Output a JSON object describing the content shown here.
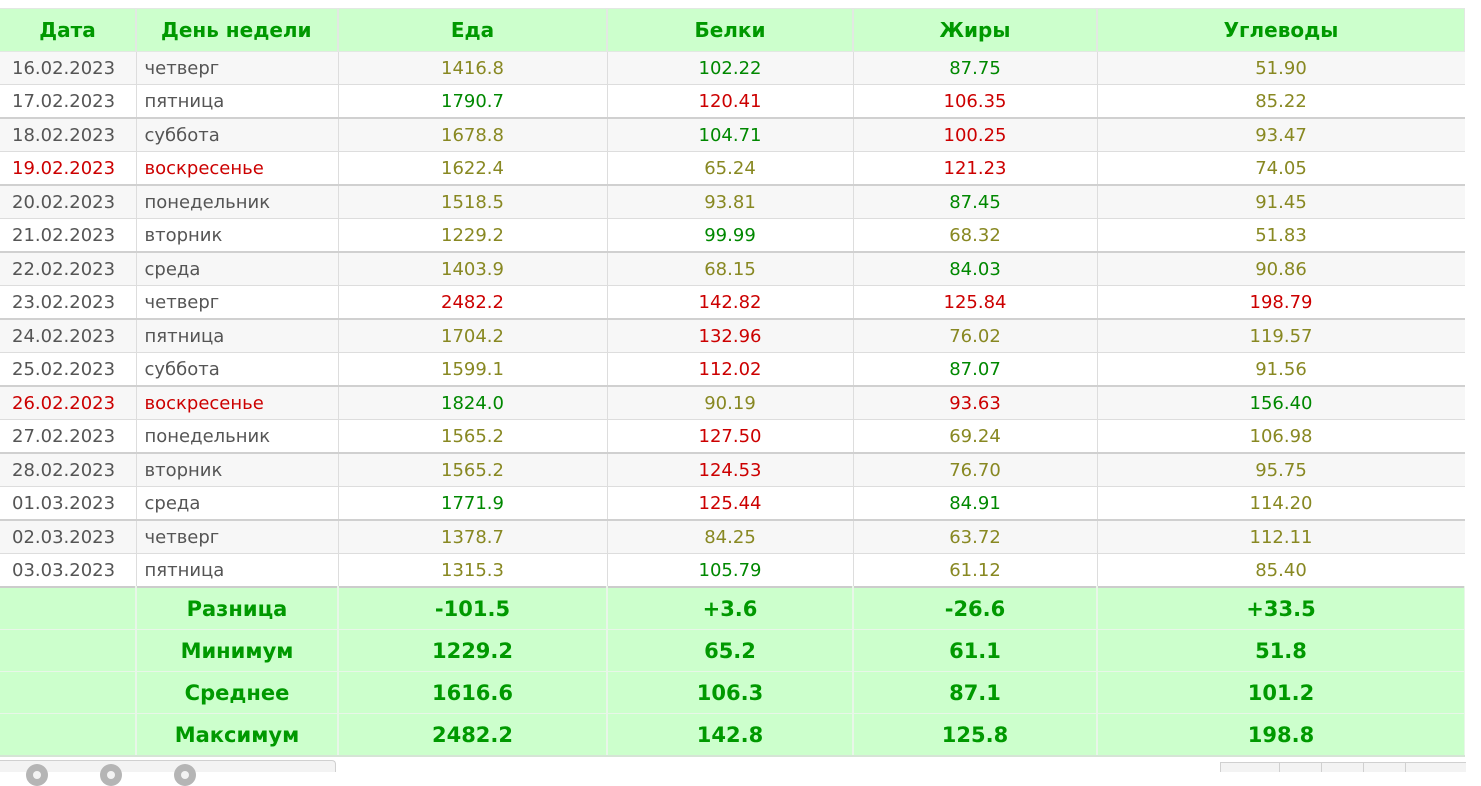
{
  "headers": {
    "date": "Дата",
    "weekday": "День недели",
    "food": "Еда",
    "protein": "Белки",
    "fat": "Жиры",
    "carbs": "Углеводы"
  },
  "rows": [
    {
      "date": "16.02.2023",
      "weekday": "четверг",
      "food": "1416.8",
      "protein": "102.22",
      "fat": "87.75",
      "carbs": "51.90",
      "weekend": false,
      "group_end": false,
      "tones": [
        "mid",
        "low",
        "low",
        "mid"
      ]
    },
    {
      "date": "17.02.2023",
      "weekday": "пятница",
      "food": "1790.7",
      "protein": "120.41",
      "fat": "106.35",
      "carbs": "85.22",
      "weekend": false,
      "group_end": true,
      "tones": [
        "low",
        "high",
        "high",
        "mid"
      ]
    },
    {
      "date": "18.02.2023",
      "weekday": "суббота",
      "food": "1678.8",
      "protein": "104.71",
      "fat": "100.25",
      "carbs": "93.47",
      "weekend": false,
      "group_end": false,
      "tones": [
        "mid",
        "low",
        "high",
        "mid"
      ]
    },
    {
      "date": "19.02.2023",
      "weekday": "воскресенье",
      "food": "1622.4",
      "protein": "65.24",
      "fat": "121.23",
      "carbs": "74.05",
      "weekend": true,
      "group_end": true,
      "tones": [
        "mid",
        "mid",
        "high",
        "mid"
      ]
    },
    {
      "date": "20.02.2023",
      "weekday": "понедельник",
      "food": "1518.5",
      "protein": "93.81",
      "fat": "87.45",
      "carbs": "91.45",
      "weekend": false,
      "group_end": false,
      "tones": [
        "mid",
        "mid",
        "low",
        "mid"
      ]
    },
    {
      "date": "21.02.2023",
      "weekday": "вторник",
      "food": "1229.2",
      "protein": "99.99",
      "fat": "68.32",
      "carbs": "51.83",
      "weekend": false,
      "group_end": true,
      "tones": [
        "mid",
        "low",
        "mid",
        "mid"
      ]
    },
    {
      "date": "22.02.2023",
      "weekday": "среда",
      "food": "1403.9",
      "protein": "68.15",
      "fat": "84.03",
      "carbs": "90.86",
      "weekend": false,
      "group_end": false,
      "tones": [
        "mid",
        "mid",
        "low",
        "mid"
      ]
    },
    {
      "date": "23.02.2023",
      "weekday": "четверг",
      "food": "2482.2",
      "protein": "142.82",
      "fat": "125.84",
      "carbs": "198.79",
      "weekend": false,
      "group_end": true,
      "tones": [
        "high",
        "high",
        "high",
        "high"
      ]
    },
    {
      "date": "24.02.2023",
      "weekday": "пятница",
      "food": "1704.2",
      "protein": "132.96",
      "fat": "76.02",
      "carbs": "119.57",
      "weekend": false,
      "group_end": false,
      "tones": [
        "mid",
        "high",
        "mid",
        "mid"
      ]
    },
    {
      "date": "25.02.2023",
      "weekday": "суббота",
      "food": "1599.1",
      "protein": "112.02",
      "fat": "87.07",
      "carbs": "91.56",
      "weekend": false,
      "group_end": true,
      "tones": [
        "mid",
        "high",
        "low",
        "mid"
      ]
    },
    {
      "date": "26.02.2023",
      "weekday": "воскресенье",
      "food": "1824.0",
      "protein": "90.19",
      "fat": "93.63",
      "carbs": "156.40",
      "weekend": true,
      "group_end": false,
      "tones": [
        "low",
        "mid",
        "high",
        "low"
      ]
    },
    {
      "date": "27.02.2023",
      "weekday": "понедельник",
      "food": "1565.2",
      "protein": "127.50",
      "fat": "69.24",
      "carbs": "106.98",
      "weekend": false,
      "group_end": true,
      "tones": [
        "mid",
        "high",
        "mid",
        "mid"
      ]
    },
    {
      "date": "28.02.2023",
      "weekday": "вторник",
      "food": "1565.2",
      "protein": "124.53",
      "fat": "76.70",
      "carbs": "95.75",
      "weekend": false,
      "group_end": false,
      "tones": [
        "mid",
        "high",
        "mid",
        "mid"
      ]
    },
    {
      "date": "01.03.2023",
      "weekday": "среда",
      "food": "1771.9",
      "protein": "125.44",
      "fat": "84.91",
      "carbs": "114.20",
      "weekend": false,
      "group_end": true,
      "tones": [
        "low",
        "high",
        "low",
        "mid"
      ]
    },
    {
      "date": "02.03.2023",
      "weekday": "четверг",
      "food": "1378.7",
      "protein": "84.25",
      "fat": "63.72",
      "carbs": "112.11",
      "weekend": false,
      "group_end": false,
      "tones": [
        "mid",
        "mid",
        "mid",
        "mid"
      ]
    },
    {
      "date": "03.03.2023",
      "weekday": "пятница",
      "food": "1315.3",
      "protein": "105.79",
      "fat": "61.12",
      "carbs": "85.40",
      "weekend": false,
      "group_end": false,
      "tones": [
        "mid",
        "low",
        "mid",
        "mid"
      ]
    }
  ],
  "summary": [
    {
      "label": "Разница",
      "food": "-101.5",
      "protein": "+3.6",
      "fat": "-26.6",
      "carbs": "+33.5"
    },
    {
      "label": "Минимум",
      "food": "1229.2",
      "protein": "65.2",
      "fat": "61.1",
      "carbs": "51.8"
    },
    {
      "label": "Среднее",
      "food": "1616.6",
      "protein": "106.3",
      "fat": "87.1",
      "carbs": "101.2"
    },
    {
      "label": "Максимум",
      "food": "2482.2",
      "protein": "142.8",
      "fat": "125.8",
      "carbs": "198.8"
    }
  ],
  "colors": {
    "header_bg": "#ccffcc",
    "header_text": "#009900",
    "value_low": "#008800",
    "value_mid": "#888822",
    "value_high": "#cc0000",
    "weekend_text": "#cc0000"
  },
  "icons": [
    "gear-icon",
    "gear-icon",
    "gear-icon"
  ]
}
